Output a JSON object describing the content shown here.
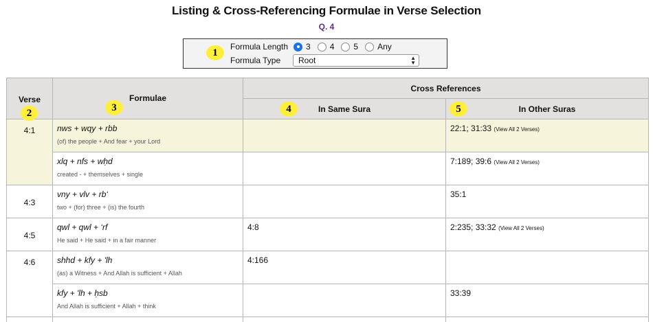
{
  "page": {
    "title": "Listing & Cross-Referencing Formulae in Verse Selection",
    "sura": "Q. 4"
  },
  "filters": {
    "length_label": "Formula Length",
    "length_options": [
      "3",
      "4",
      "5",
      "Any"
    ],
    "length_selected": "3",
    "type_label": "Formula Type",
    "type_value": "Root"
  },
  "badges": [
    "1",
    "2",
    "3",
    "4",
    "5"
  ],
  "table": {
    "headers": {
      "verse": "Verse",
      "formulae": "Formulae",
      "cross_refs": "Cross References",
      "same_sura": "In Same Sura",
      "other_suras": "In Other Suras"
    },
    "rows": [
      {
        "verse": "4:1",
        "formula": "nws + wqy + rbb",
        "gloss": "(of) the people + And fear + your Lord",
        "same": "",
        "other": "22:1; 31:33",
        "other_link": "(View All 2 Verses)"
      },
      {
        "verse": "",
        "formula": "xlq + nfs + wḥd",
        "gloss": "created - + themselves + single",
        "same": "",
        "other": "7:189; 39:6",
        "other_link": "(View All 2 Verses)"
      },
      {
        "verse": "4:3",
        "formula": "vny + vlv + rb‘",
        "gloss": "two + (for) three + (is) the fourth",
        "same": "",
        "other": "35:1",
        "other_link": ""
      },
      {
        "verse": "4:5",
        "formula": "qwl + qwl + ‘rf",
        "gloss": "He said + He said + in a fair manner",
        "same": "4:8",
        "other": "2:235; 33:32",
        "other_link": "(View All 2 Verses)"
      },
      {
        "verse": "4:6",
        "formula": "shhd + kfy + 'lh",
        "gloss": "(as) a Witness + And Allah is sufficient + Allah",
        "same": "4:166",
        "other": "",
        "other_link": ""
      },
      {
        "verse": "",
        "formula": "kfy + 'lh + ḥsb",
        "gloss": "And Allah is sufficient + Allah + think",
        "same": "",
        "other": "33:39",
        "other_link": ""
      }
    ]
  },
  "colors": {
    "highlight_row": "#f6f5dc",
    "header_bg": "#e3e1df",
    "sura_link": "#5b2d8e",
    "badge": "#ffef3a",
    "radio_selected": "#1a73e8"
  }
}
